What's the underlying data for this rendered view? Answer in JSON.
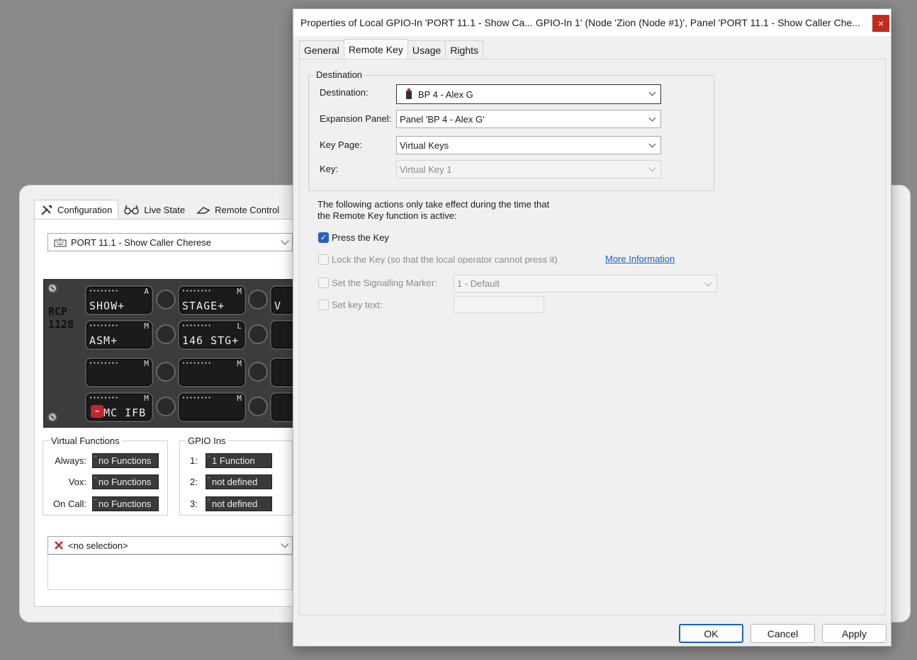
{
  "bg_window": {
    "tabs": [
      {
        "label": "Configuration",
        "icon": "tools-icon"
      },
      {
        "label": "Live State",
        "icon": "glasses-icon"
      },
      {
        "label": "Remote Control",
        "icon": "remote-icon"
      }
    ],
    "panel_select": "PORT 11.1 - Show Caller Cherese",
    "device_label_line1": "RCP",
    "device_label_line2": "1128",
    "keys": [
      {
        "text": "SHOW+",
        "mode": "A"
      },
      {
        "text": "STAGE+",
        "mode": "M"
      },
      {
        "text": "ASM+",
        "mode": "M"
      },
      {
        "text": "146 STG+",
        "mode": "L"
      },
      {
        "text": "",
        "mode": "M"
      },
      {
        "text": "",
        "mode": "M"
      },
      {
        "text": "MC IFB",
        "mode": "M"
      },
      {
        "text": "",
        "mode": "M"
      }
    ],
    "partial_key_text": "V",
    "key_dots": "••••••••",
    "virtual_functions": {
      "title": "Virtual Functions",
      "rows": [
        {
          "label": "Always:",
          "value": "no Functions"
        },
        {
          "label": "Vox:",
          "value": "no Functions"
        },
        {
          "label": "On Call:",
          "value": "no Functions"
        }
      ]
    },
    "gpio_ins": {
      "title": "GPIO Ins",
      "rows": [
        {
          "label": "1:",
          "value": "1 Function"
        },
        {
          "label": "2:",
          "value": "not defined"
        },
        {
          "label": "3:",
          "value": "not defined"
        }
      ]
    },
    "selection": "<no selection>"
  },
  "dialog": {
    "title": "Properties of Local GPIO-In 'PORT 11.1 - Show Ca... GPIO-In 1' (Node 'Zion (Node #1)', Panel 'PORT 11.1 - Show Caller Che...",
    "close": "×",
    "tabs": [
      "General",
      "Remote Key",
      "Usage",
      "Rights"
    ],
    "destination_group": "Destination",
    "fields": {
      "destination_label": "Destination:",
      "destination_value": "BP 4 - Alex G",
      "expansion_label": "Expansion Panel:",
      "expansion_value": "Panel 'BP 4 - Alex G'",
      "keypage_label": "Key Page:",
      "keypage_value": "Virtual Keys",
      "key_label": "Key:",
      "key_value": "Virtual Key 1"
    },
    "note_line1": "The following actions only take effect during the time that",
    "note_line2": "the Remote Key function is active:",
    "press_key": "Press the Key",
    "lock_key": "Lock the Key (so that the local operator cannot press it)",
    "more_info": "More Information",
    "signalling_label": "Set the Signalling Marker:",
    "signalling_value": "1 - Default",
    "set_key_text": "Set key text:",
    "buttons": {
      "ok": "OK",
      "cancel": "Cancel",
      "apply": "Apply"
    }
  }
}
